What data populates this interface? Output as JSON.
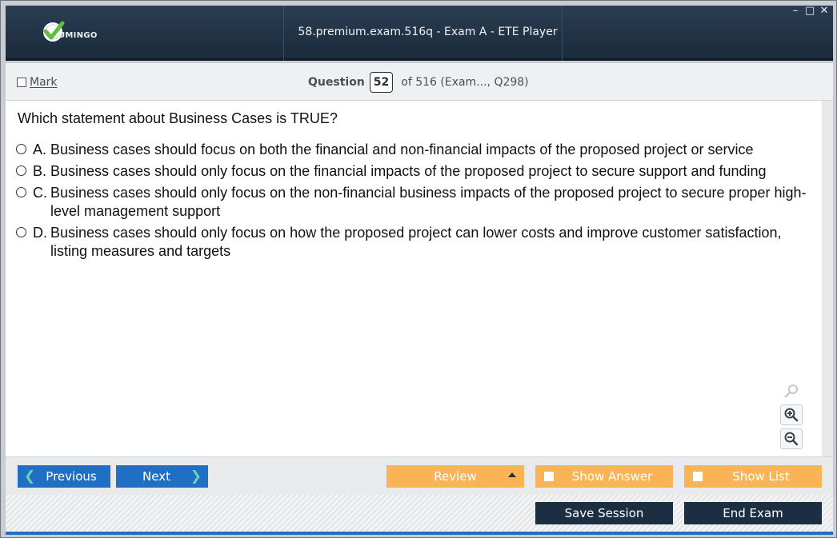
{
  "window": {
    "title": "58.premium.exam.516q - Exam A - ETE Player",
    "controls": [
      "–",
      "□",
      "✕"
    ]
  },
  "logo": {
    "text": "UMINGO",
    "mark_icon": "green-check-icon",
    "brand_color": "#5bbf3a"
  },
  "question_bar": {
    "mark_label": "Mark",
    "question_label": "Question",
    "question_number": "52",
    "of_text": "of 516 (Exam..., Q298)"
  },
  "question": {
    "text": "Which statement about Business Cases is TRUE?",
    "options": [
      {
        "letter": "A.",
        "text": "Business cases should focus on both the financial and non-financial impacts of the proposed project or service"
      },
      {
        "letter": "B.",
        "text": "Business cases should only focus on the financial impacts of the proposed project to secure support and funding"
      },
      {
        "letter": "C.",
        "text": "Business cases should only focus on the non-financial business impacts of the proposed project to secure proper high-level management support"
      },
      {
        "letter": "D.",
        "text": "Business cases should only focus on how the proposed project can lower costs and improve customer satisfaction, listing measures and targets"
      }
    ]
  },
  "zoom": {
    "icons": [
      "search-icon",
      "zoom-in-icon",
      "zoom-out-icon"
    ]
  },
  "nav": {
    "previous_label": "Previous",
    "next_label": "Next",
    "review_label": "Review",
    "show_answer_label": "Show Answer",
    "show_list_label": "Show List"
  },
  "footer": {
    "save_session_label": "Save Session",
    "end_exam_label": "End Exam"
  },
  "colors": {
    "accent_blue": "#1f6fc5",
    "orange": "#fbb455",
    "dark_navy": "#1c2f42",
    "title_bar": "#1b2b3c"
  }
}
